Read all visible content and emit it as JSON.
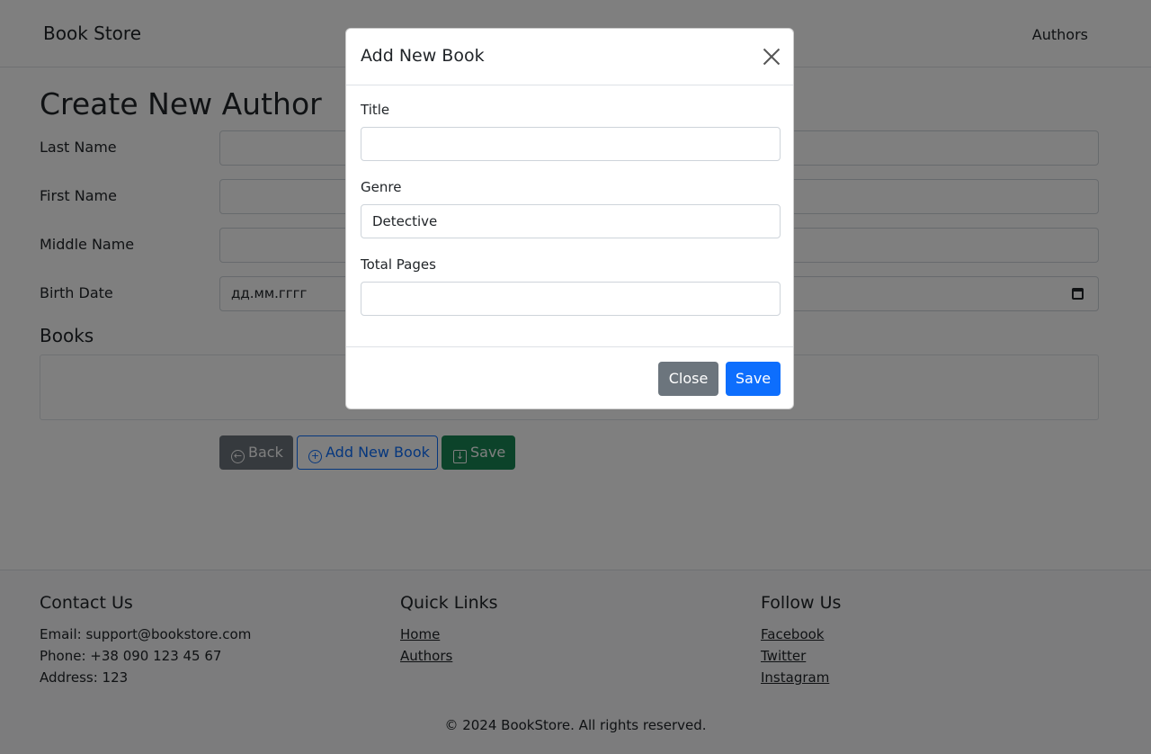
{
  "navbar": {
    "brand": "Book Store",
    "authors_link": "Authors"
  },
  "form": {
    "title": "Create New Author",
    "fields": [
      {
        "label": "Last Name",
        "value": ""
      },
      {
        "label": "First Name",
        "value": ""
      },
      {
        "label": "Middle Name",
        "value": ""
      },
      {
        "label": "Birth Date",
        "value": "дд.мм.гггг"
      }
    ],
    "books_heading": "Books",
    "books_empty": "",
    "back_button": "Back",
    "add_book_button": "Add New Book",
    "save_button": "Save"
  },
  "footer": {
    "contact": {
      "heading": "Contact Us",
      "email": "Email: support@bookstore.com",
      "phone": "Phone: +38 090 123 45 67",
      "address": "Address: 123"
    },
    "quick_links": {
      "heading": "Quick Links",
      "home": "Home",
      "authors": "Authors"
    },
    "follow": {
      "heading": "Follow Us",
      "facebook": "Facebook",
      "twitter": "Twitter",
      "instagram": "Instagram"
    },
    "copyright": "© 2024 BookStore. All rights reserved."
  },
  "modal": {
    "title": "Add New Book",
    "title_label": "Title",
    "title_value": "",
    "genre_label": "Genre",
    "genre_value": "Detective",
    "pages_label": "Total Pages",
    "pages_value": "",
    "close_button": "Close",
    "save_button": "Save"
  },
  "colors": {
    "primary": "#0d6efd",
    "secondary": "#6c757d",
    "success": "#198754"
  }
}
